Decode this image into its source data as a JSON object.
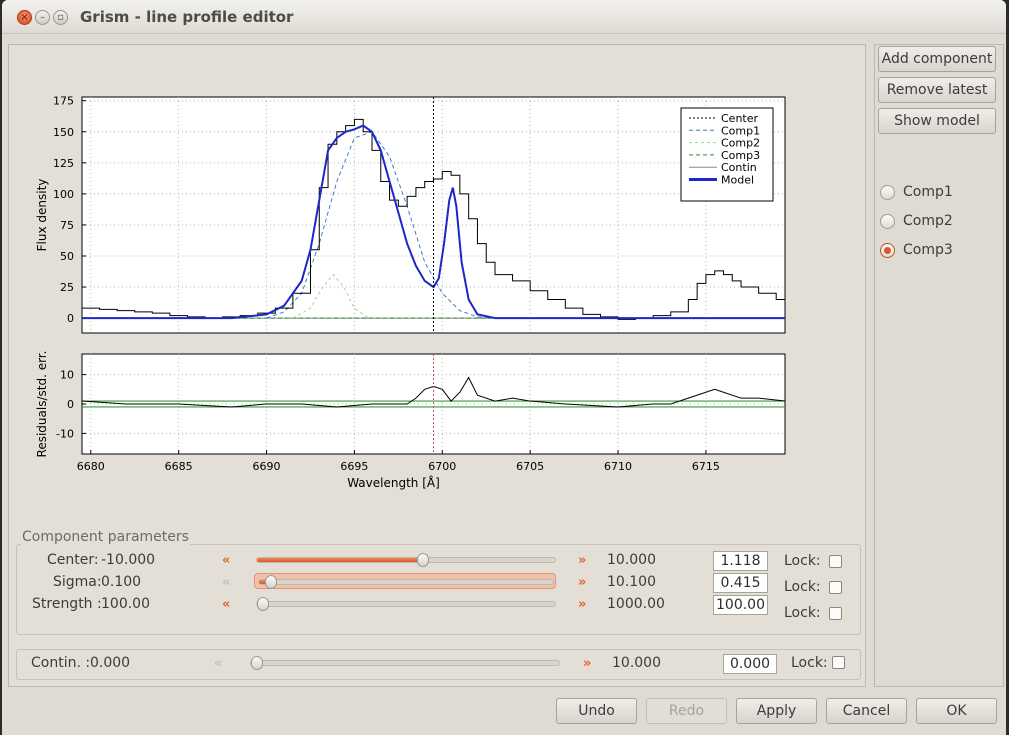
{
  "window": {
    "title": "Grism - line profile editor"
  },
  "side_buttons": {
    "add": "Add component",
    "remove": "Remove latest",
    "show": "Show model"
  },
  "components": [
    {
      "label": "Comp1",
      "selected": false
    },
    {
      "label": "Comp2",
      "selected": false
    },
    {
      "label": "Comp3",
      "selected": true
    }
  ],
  "params": {
    "group_title": "Component parameters",
    "center": {
      "label": "Center:",
      "min": "-10.000",
      "max": "10.000",
      "value": "1.118",
      "lock": "Lock:",
      "level": 0.555
    },
    "sigma": {
      "label": "Sigma:",
      "min": "0.100",
      "max": "10.100",
      "value": "0.415",
      "lock": "Lock:",
      "level": 0.032
    },
    "strength": {
      "label": "Strength :",
      "min": "100.00",
      "max": "1000.00",
      "value": "100.00",
      "lock": "Lock:",
      "level": 0.0
    }
  },
  "contin": {
    "label": "Contin. :",
    "min": "0.000",
    "max": "10.000",
    "value": "0.000",
    "lock": "Lock:",
    "level": 0.0
  },
  "bottom_buttons": {
    "undo": "Undo",
    "redo": "Redo",
    "apply": "Apply",
    "cancel": "Cancel",
    "ok": "OK"
  },
  "chart_data": [
    {
      "type": "line",
      "ylabel": "Flux density",
      "xlim": [
        6679.5,
        6719.5
      ],
      "ylim": [
        -12,
        178
      ],
      "yticks": [
        0,
        25,
        50,
        75,
        100,
        125,
        150,
        175
      ],
      "center_marker": 6699.5,
      "legend": {
        "placement": "top-right",
        "entries": [
          "Center",
          "Comp1",
          "Comp2",
          "Comp3",
          "Contin",
          "Model"
        ]
      },
      "series": [
        {
          "name": "Data",
          "x": [
            6679.5,
            6680.5,
            6681.5,
            6682.5,
            6683.5,
            6684.5,
            6685.5,
            6686.5,
            6687.5,
            6688.5,
            6689.5,
            6690.5,
            6691.5,
            6692.5,
            6693.0,
            6693.5,
            6694.0,
            6694.5,
            6695.0,
            6695.5,
            6696.0,
            6696.5,
            6697.0,
            6697.5,
            6698.0,
            6698.5,
            6699.0,
            6699.5,
            6700.0,
            6700.5,
            6701.0,
            6701.5,
            6702.0,
            6702.5,
            6703.0,
            6704.0,
            6705.0,
            6706.0,
            6707.0,
            6708.0,
            6709.0,
            6710.0,
            6711.0,
            6712.0,
            6713.0,
            6714.0,
            6714.5,
            6715.0,
            6715.5,
            6716.0,
            6716.5,
            6717.0,
            6718.0,
            6719.0,
            6719.5
          ],
          "y": [
            8,
            7,
            6,
            5,
            4,
            2,
            1,
            0,
            1,
            2,
            4,
            8,
            20,
            55,
            105,
            140,
            150,
            155,
            160,
            150,
            135,
            110,
            95,
            90,
            98,
            105,
            110,
            112,
            118,
            115,
            100,
            80,
            60,
            45,
            35,
            30,
            22,
            15,
            8,
            3,
            1,
            -1,
            0,
            2,
            5,
            15,
            28,
            35,
            38,
            35,
            30,
            25,
            20,
            15,
            12
          ]
        },
        {
          "name": "Model",
          "x": [
            6679.5,
            6688,
            6690,
            6691,
            6692,
            6692.5,
            6693,
            6693.5,
            6694,
            6694.5,
            6695,
            6695.5,
            6696,
            6696.5,
            6697,
            6697.5,
            6698,
            6698.5,
            6699,
            6699.5,
            6699.8,
            6700.1,
            6700.4,
            6700.6,
            6700.8,
            6701.1,
            6701.5,
            6702,
            6703,
            6719.5
          ],
          "y": [
            0,
            0,
            3,
            10,
            30,
            55,
            95,
            135,
            145,
            150,
            152,
            155,
            150,
            135,
            110,
            85,
            60,
            42,
            30,
            25,
            32,
            60,
            95,
            105,
            90,
            45,
            15,
            3,
            0,
            0
          ]
        },
        {
          "name": "Comp1",
          "x": [
            6690,
            6691,
            6692,
            6693,
            6694,
            6695,
            6696,
            6697,
            6698,
            6699,
            6700,
            6701,
            6702,
            6703
          ],
          "y": [
            0,
            5,
            20,
            60,
            110,
            145,
            150,
            130,
            90,
            45,
            20,
            6,
            1,
            0
          ]
        },
        {
          "name": "Comp2",
          "x": [
            6691.5,
            6692.5,
            6693.2,
            6693.8,
            6694.4,
            6695,
            6695.8
          ],
          "y": [
            0,
            8,
            25,
            35,
            25,
            8,
            0
          ]
        },
        {
          "name": "Comp3",
          "x": [
            6679.5,
            6719.5
          ],
          "y": [
            0,
            0
          ]
        },
        {
          "name": "Contin",
          "x": [
            6679.5,
            6719.5
          ],
          "y": [
            0,
            0
          ]
        }
      ]
    },
    {
      "type": "line",
      "xlabel": "Wavelength [Å]",
      "ylabel": "Residuals/std. err.",
      "xlim": [
        6679.5,
        6719.5
      ],
      "ylim": [
        -17,
        17
      ],
      "yticks": [
        -10,
        0,
        10
      ],
      "xticks": [
        6680,
        6685,
        6690,
        6695,
        6700,
        6705,
        6710,
        6715
      ],
      "bands": [
        1,
        -1
      ],
      "center_marker": 6699.5,
      "series": [
        {
          "name": "Residuals",
          "x": [
            6679.5,
            6682,
            6685,
            6688,
            6690,
            6692,
            6694,
            6696,
            6697,
            6698,
            6698.5,
            6699,
            6699.5,
            6700,
            6700.5,
            6701,
            6701.5,
            6702,
            6703,
            6704,
            6705,
            6707,
            6710,
            6712,
            6713,
            6714,
            6715,
            6715.5,
            6716,
            6716.5,
            6717,
            6718,
            6719.5
          ],
          "y": [
            1,
            0,
            0,
            -1,
            0,
            0,
            -1,
            0,
            0,
            0,
            2,
            5,
            6,
            5,
            1,
            4,
            9,
            3,
            1,
            2,
            1,
            0,
            -1,
            0,
            0,
            2,
            4,
            5,
            4,
            3,
            2,
            2,
            1
          ]
        }
      ]
    }
  ]
}
